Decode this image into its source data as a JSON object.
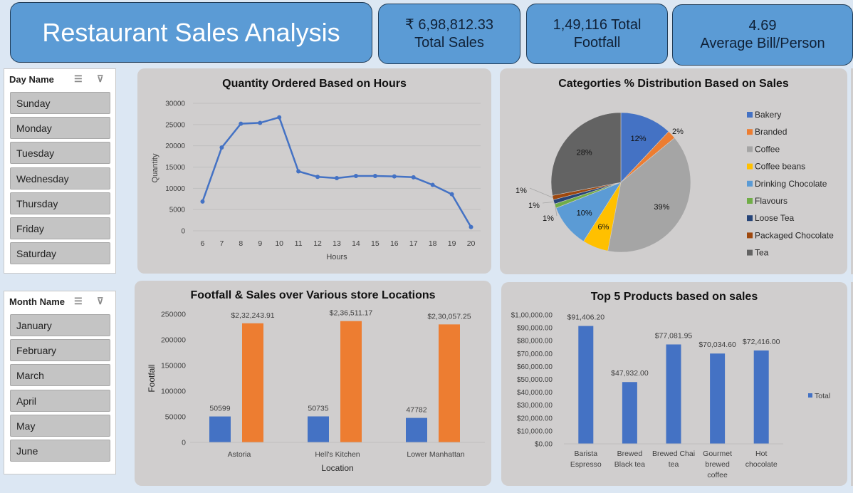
{
  "header": {
    "title": "Restaurant Sales Analysis",
    "kpis": [
      {
        "value": "₹ 6,98,812.33",
        "label": "Total Sales"
      },
      {
        "value": "1,49,116 Total",
        "label": "Footfall"
      },
      {
        "value": "4.69",
        "label": "Average Bill/Person"
      }
    ]
  },
  "slicers": {
    "day": {
      "title": "Day Name",
      "items": [
        "Sunday",
        "Monday",
        "Tuesday",
        "Wednesday",
        "Thursday",
        "Friday",
        "Saturday"
      ]
    },
    "month": {
      "title": "Month Name",
      "items": [
        "January",
        "February",
        "March",
        "April",
        "May",
        "June"
      ]
    }
  },
  "chart_data": [
    {
      "type": "line",
      "title": "Quantity Ordered Based on Hours",
      "xlabel": "Hours",
      "ylabel": "Quantity",
      "x": [
        6,
        7,
        8,
        9,
        10,
        11,
        12,
        13,
        14,
        15,
        16,
        17,
        18,
        19,
        20
      ],
      "values": [
        6900,
        19600,
        25200,
        25400,
        26700,
        14000,
        12700,
        12400,
        12900,
        12900,
        12800,
        12600,
        10800,
        8600,
        900
      ],
      "ylim": [
        0,
        30000
      ],
      "yticks": [
        "0",
        "5000",
        "10000",
        "15000",
        "20000",
        "25000",
        "30000"
      ],
      "color": "#4472c4",
      "grid": true
    },
    {
      "type": "pie",
      "title": "Categorties % Distribution Based on Sales",
      "categories": [
        "Bakery",
        "Branded",
        "Coffee",
        "Coffee beans",
        "Drinking Chocolate",
        "Flavours",
        "Loose Tea",
        "Packaged Chocolate",
        "Tea"
      ],
      "values": [
        12,
        2,
        39,
        6,
        10,
        1,
        1,
        1,
        28
      ],
      "labels": [
        "12%",
        "2%",
        "39%",
        "6%",
        "10%",
        "1%",
        "1%",
        "1%",
        "28%"
      ],
      "colors": [
        "#4472c4",
        "#ed7d31",
        "#a5a5a5",
        "#ffc000",
        "#5b9bd5",
        "#70ad47",
        "#264478",
        "#9e480e",
        "#636363"
      ],
      "legend": "right"
    },
    {
      "type": "bar",
      "title": "Footfall & Sales over Various store Locations",
      "xlabel": "Location",
      "ylabel": "Footfall",
      "categories": [
        "Astoria",
        "Hell's Kitchen",
        "Lower Manhattan"
      ],
      "series": [
        {
          "values": [
            50599,
            50735,
            47782
          ],
          "labels": [
            "50599",
            "50735",
            "47782"
          ],
          "color": "#4472c4"
        },
        {
          "values": [
            232243.91,
            236511.17,
            230057.25
          ],
          "labels": [
            "$2,32,243.91",
            "$2,36,511.17",
            "$2,30,057.25"
          ],
          "color": "#ed7d31"
        }
      ],
      "ylim": [
        0,
        250000
      ],
      "yticks": [
        "0",
        "50000",
        "100000",
        "150000",
        "200000",
        "250000"
      ]
    },
    {
      "type": "bar",
      "title": "Top 5 Products based on sales",
      "categories": [
        "Barista Espresso",
        "Brewed Black tea",
        "Brewed Chai tea",
        "Gourmet brewed coffee",
        "Hot chocolate"
      ],
      "category_lines": [
        [
          "Barista",
          "Espresso"
        ],
        [
          "Brewed",
          "Black tea"
        ],
        [
          "Brewed Chai",
          "tea"
        ],
        [
          "Gourmet",
          "brewed",
          "coffee"
        ],
        [
          "Hot",
          "chocolate"
        ]
      ],
      "series": [
        {
          "name": "Total",
          "values": [
            91406.2,
            47932.0,
            77081.95,
            70034.6,
            72416.0
          ],
          "labels": [
            "$91,406.20",
            "$47,932.00",
            "$77,081.95",
            "$70,034.60",
            "$72,416.00"
          ],
          "color": "#4472c4"
        }
      ],
      "ylim": [
        0,
        100000
      ],
      "yticks": [
        "$0.00",
        "$10,000.00",
        "$20,000.00",
        "$30,000.00",
        "$40,000.00",
        "$50,000.00",
        "$60,000.00",
        "$70,000.00",
        "$80,000.00",
        "$90,000.00",
        "$1,00,000.00"
      ],
      "legend": "right"
    }
  ]
}
